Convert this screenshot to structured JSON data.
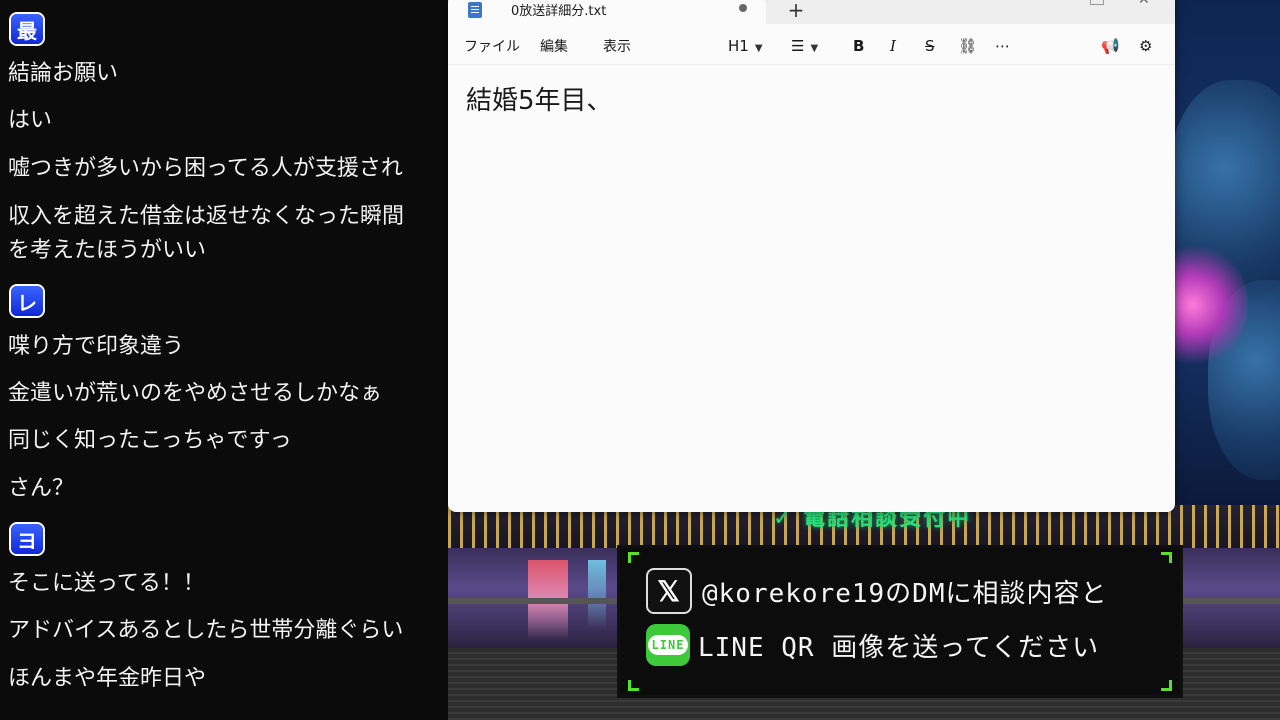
{
  "chat": {
    "messages": [
      {
        "badge": "最",
        "lines": [
          "結論お願い",
          "はい",
          "嘘つきが多いから困ってる人が支援され",
          "収入を超えた借金は返せなくなった瞬間",
          "を考えたほうがいい"
        ]
      },
      {
        "badge": "レ",
        "lines": [
          "喋り方で印象違う",
          "金遣いが荒いのをやめさせるしかなぁ",
          "同じく知ったこっちゃですっ",
          "さん？"
        ]
      },
      {
        "badge": "ヨ",
        "lines": [
          "そこに送ってる！！",
          "アドバイスあるとしたら世帯分離ぐらい",
          "ほんまや年金昨日や"
        ]
      }
    ]
  },
  "notepad": {
    "tab_title": "0放送詳細分.txt",
    "new_tab": "+",
    "menu": {
      "file": "ファイル",
      "edit": "編集",
      "view": "表示"
    },
    "toolbar": {
      "heading": "H1",
      "bold": "B",
      "italic": "I",
      "strike": "S"
    },
    "content": "結婚5年目、"
  },
  "overlay": {
    "neon_text": "✓ 電話相談受付中",
    "x_logo": "𝕏",
    "x_line": "@korekore19のDMに相談内容と",
    "line_logo": "LINE",
    "line_line": "LINE QR 画像を送ってください"
  },
  "colors": {
    "accent_green": "#58e02a",
    "badge_blue": "#2040e8",
    "line_green": "#3ec93a"
  }
}
